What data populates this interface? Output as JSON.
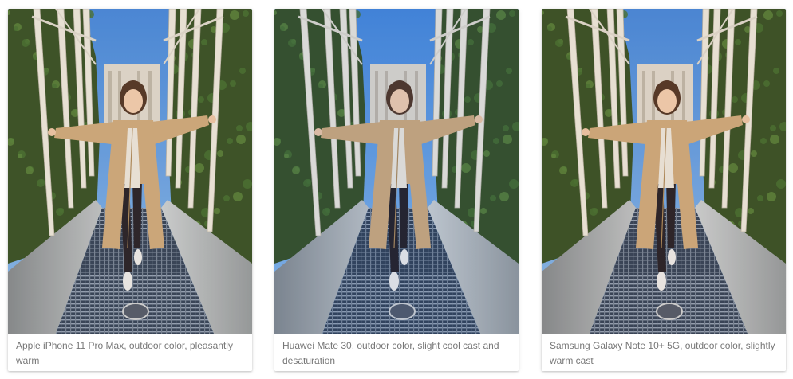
{
  "cards": [
    {
      "caption": "Apple iPhone 11 Pro Max, outdoor color, pleasantly warm",
      "tint": "#f0c070",
      "tint_opacity": 0.08
    },
    {
      "caption": "Huawei Mate 30, outdoor color, slight cool cast and desaturation",
      "tint": "#6a88b0",
      "tint_opacity": 0.1
    },
    {
      "caption": "Samsung Galaxy Note 10+ 5G, outdoor color, slightly warm cast",
      "tint": "#f0b860",
      "tint_opacity": 0.08
    }
  ],
  "colors": {
    "sky": "#4a8fe0",
    "foliage": "#2f4a22",
    "coat": "#c8a47a",
    "steel": "#aeb4ba"
  }
}
